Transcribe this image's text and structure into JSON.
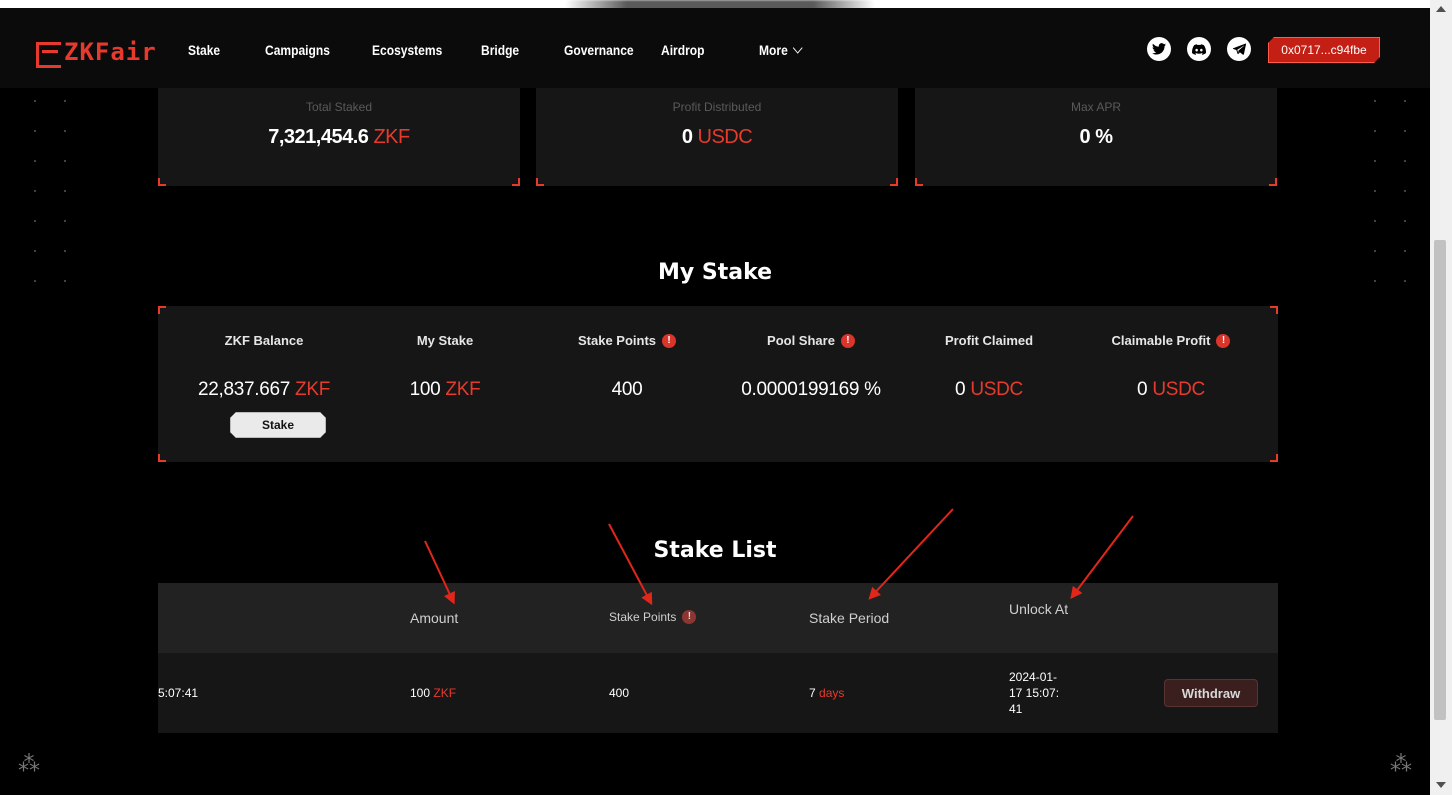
{
  "nav": {
    "logo_text": "ZKFair",
    "links": [
      "Stake",
      "Campaigns",
      "Ecosystems",
      "Bridge",
      "Governance",
      "Airdrop",
      "More"
    ],
    "social_icons": [
      "twitter-icon",
      "discord-icon",
      "telegram-icon"
    ],
    "wallet": "0x0717...c94fbe"
  },
  "stats": [
    {
      "label": "Total Staked",
      "value": "7,321,454.6",
      "unit": "ZKF"
    },
    {
      "label": "Profit Distributed",
      "value": "0",
      "unit": "USDC"
    },
    {
      "label": "Max APR",
      "value": "0 %",
      "unit": ""
    }
  ],
  "my_stake": {
    "title": "My Stake",
    "columns": [
      {
        "label": "ZKF Balance",
        "value": "22,837.667",
        "unit": "ZKF",
        "info": false
      },
      {
        "label": "My Stake",
        "value": "100",
        "unit": "ZKF",
        "info": false
      },
      {
        "label": "Stake Points",
        "value": "400",
        "unit": "",
        "info": true
      },
      {
        "label": "Pool Share",
        "value": "0.0000199169 %",
        "unit": "",
        "info": true
      },
      {
        "label": "Profit Claimed",
        "value": "0",
        "unit": "USDC",
        "info": false
      },
      {
        "label": "Claimable Profit",
        "value": "0",
        "unit": "USDC",
        "info": true
      }
    ],
    "stake_button": "Stake"
  },
  "stake_list": {
    "title": "Stake List",
    "headers": {
      "amount": "Amount",
      "stake_points": "Stake Points",
      "stake_period": "Stake Period",
      "unlock_at": "Unlock At"
    },
    "rows": [
      {
        "time": "5:07:41",
        "amount": "100",
        "amount_unit": "ZKF",
        "stake_points": "400",
        "period": "7",
        "period_unit": "days",
        "unlock_at_lines": [
          "2024-01-",
          "17 15:07:",
          "41"
        ],
        "action": "Withdraw"
      }
    ]
  },
  "colors": {
    "accent": "#e83a2c",
    "background": "#000000",
    "card": "#161616",
    "arrow": "#e1261a"
  }
}
